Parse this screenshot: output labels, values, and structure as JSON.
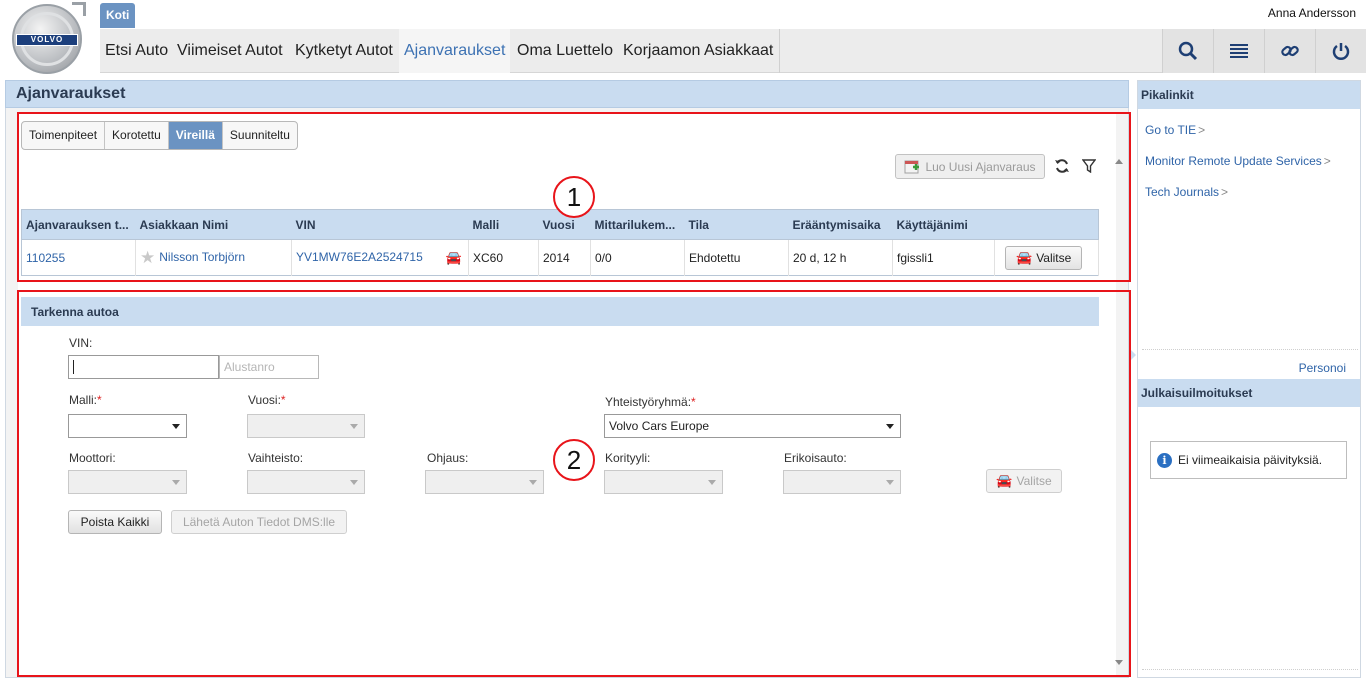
{
  "header": {
    "logo_text": "VOLVO",
    "home_tab": "Koti",
    "username": "Anna Andersson",
    "nav": [
      "Etsi Auto",
      "Viimeiset Autot",
      "Kytketyt Autot",
      "Ajanvaraukset",
      "Oma Luettelo",
      "Korjaamon Asiakkaat"
    ],
    "active_nav": "Ajanvaraukset",
    "icons": [
      "search-icon",
      "list-icon",
      "link-icon",
      "power-icon"
    ]
  },
  "main": {
    "title": "Ajanvaraukset",
    "tabs": [
      "Toimenpiteet",
      "Korotettu",
      "Vireillä",
      "Suunniteltu"
    ],
    "active_tab": "Vireillä",
    "new_booking_label": "Luo Uusi Ajanvaraus",
    "table": {
      "headers": [
        "Ajanvarauksen t...",
        "Asiakkaan Nimi",
        "VIN",
        "Malli",
        "Vuosi",
        "Mittarilukem...",
        "Tila",
        "Erääntymisaika",
        "Käyttäjänimi",
        ""
      ],
      "rows": [
        {
          "id": "110255",
          "customer": "Nilsson Torbjörn",
          "vin": "YV1MW76E2A2524715",
          "model": "XC60",
          "year": "2014",
          "odometer": "0/0",
          "status": "Ehdotettu",
          "due": "20 d, 12 h",
          "user": "fgissli1",
          "action": "Valitse"
        }
      ]
    }
  },
  "refine": {
    "title": "Tarkenna autoa",
    "vin_label": "VIN:",
    "vin_value": "",
    "alustanro_placeholder": "Alustanro",
    "malli_label": "Malli:",
    "vuosi_label": "Vuosi:",
    "yhteistyo_label": "Yhteistyöryhmä:",
    "yhteistyo_value": "Volvo Cars Europe",
    "moottori_label": "Moottori:",
    "vaihteisto_label": "Vaihteisto:",
    "ohjaus_label": "Ohjaus:",
    "korityyli_label": "Korityyli:",
    "erikoisauto_label": "Erikoisauto:",
    "valitse_label": "Valitse",
    "clear_label": "Poista Kaikki",
    "send_label": "Lähetä Auton Tiedot DMS:lle"
  },
  "annotations": [
    "1",
    "2"
  ],
  "sidebar": {
    "quicklinks_title": "Pikalinkit",
    "links": [
      "Go to TIE",
      "Monitor Remote Update Services",
      "Tech Journals"
    ],
    "personalize": "Personoi",
    "announcements_title": "Julkaisuilmoitukset",
    "no_updates": "Ei viimeaikaisia päivityksiä."
  },
  "colors": {
    "accent": "#6b93c2",
    "panel_header": "#c9dcf0",
    "link": "#2f64a8",
    "annotation": "#e8141a"
  }
}
